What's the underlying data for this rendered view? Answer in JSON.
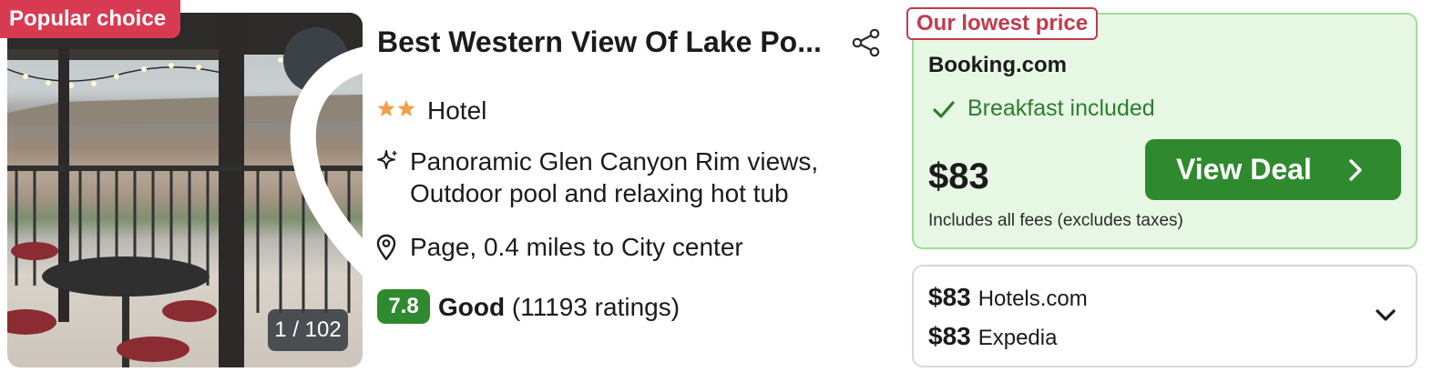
{
  "badge": {
    "popular": "Popular choice"
  },
  "photo": {
    "counter": "1 / 102"
  },
  "hotel": {
    "name": "Best Western View Of Lake Po...",
    "stars": 2,
    "type": "Hotel",
    "features": [
      "Panoramic Glen Canyon Rim views,",
      "Outdoor pool and relaxing hot tub"
    ],
    "location": "Page, 0.4 miles to City center",
    "rating": {
      "score": "7.8",
      "word": "Good",
      "count": "(11193 ratings)"
    }
  },
  "deal": {
    "tag": "Our lowest price",
    "provider": "Booking.com",
    "perk": "Breakfast included",
    "price": "$83",
    "fees_note": "Includes all fees (excludes taxes)",
    "button_label": "View Deal"
  },
  "other_deals": [
    {
      "price": "$83",
      "provider": "Hotels.com"
    },
    {
      "price": "$83",
      "provider": "Expedia"
    }
  ],
  "colors": {
    "popular_badge": "#d83a52",
    "deal_green": "#2f8a2f",
    "deal_bg": "#e6f8e4",
    "lowest_tag": "#c23a4d",
    "star": "#f0a04b"
  }
}
